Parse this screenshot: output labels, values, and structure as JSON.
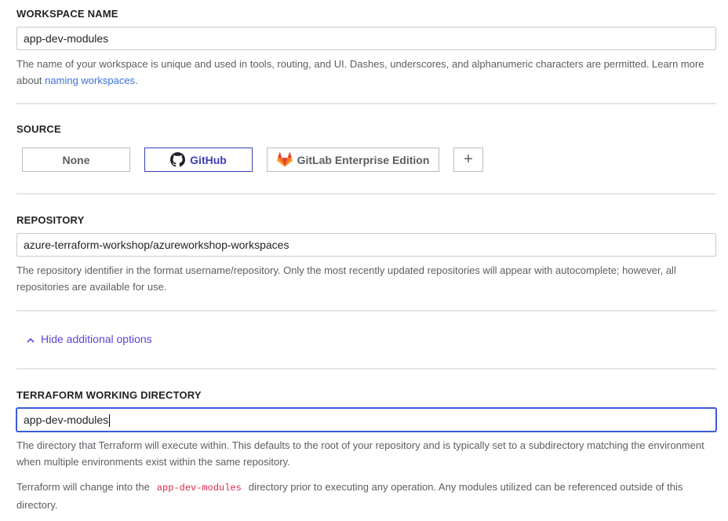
{
  "workspace_name": {
    "label": "WORKSPACE NAME",
    "value": "app-dev-modules",
    "help_text": "The name of your workspace is unique and used in tools, routing, and UI. Dashes, underscores, and alphanumeric characters are permitted. Learn more about ",
    "help_link": "naming workspaces",
    "help_suffix": "."
  },
  "source": {
    "label": "SOURCE",
    "options": [
      {
        "label": "None",
        "icon": null,
        "selected": false
      },
      {
        "label": "GitHub",
        "icon": "github-icon",
        "selected": true
      },
      {
        "label": "GitLab Enterprise Edition",
        "icon": "gitlab-icon",
        "selected": false
      },
      {
        "label": "+",
        "icon": "plus-icon",
        "selected": false
      }
    ]
  },
  "repository": {
    "label": "REPOSITORY",
    "value": "azure-terraform-workshop/azureworkshop-workspaces",
    "help_text": "The repository identifier in the format username/repository. Only the most recently updated repositories will appear with autocomplete; however, all repositories are available for use."
  },
  "additional_options": {
    "toggle_label": "Hide additional options",
    "icon": "chevron-up-icon"
  },
  "working_directory": {
    "label": "TERRAFORM WORKING DIRECTORY",
    "value": "app-dev-modules",
    "help_text": "The directory that Terraform will execute within. This defaults to the root of your repository and is typically set to a subdirectory matching the environment when multiple environments exist within the same repository.",
    "note_prefix": "Terraform will change into the",
    "note_code": "app-dev-modules",
    "note_suffix": "directory prior to executing any operation. Any modules utilized can be referenced outside of this directory."
  },
  "colors": {
    "accent": "#3b3fb6",
    "link": "#3a6fd6",
    "toggle": "#5b46d6",
    "code": "#e0264d",
    "gitlab_orange": "#e24329"
  }
}
